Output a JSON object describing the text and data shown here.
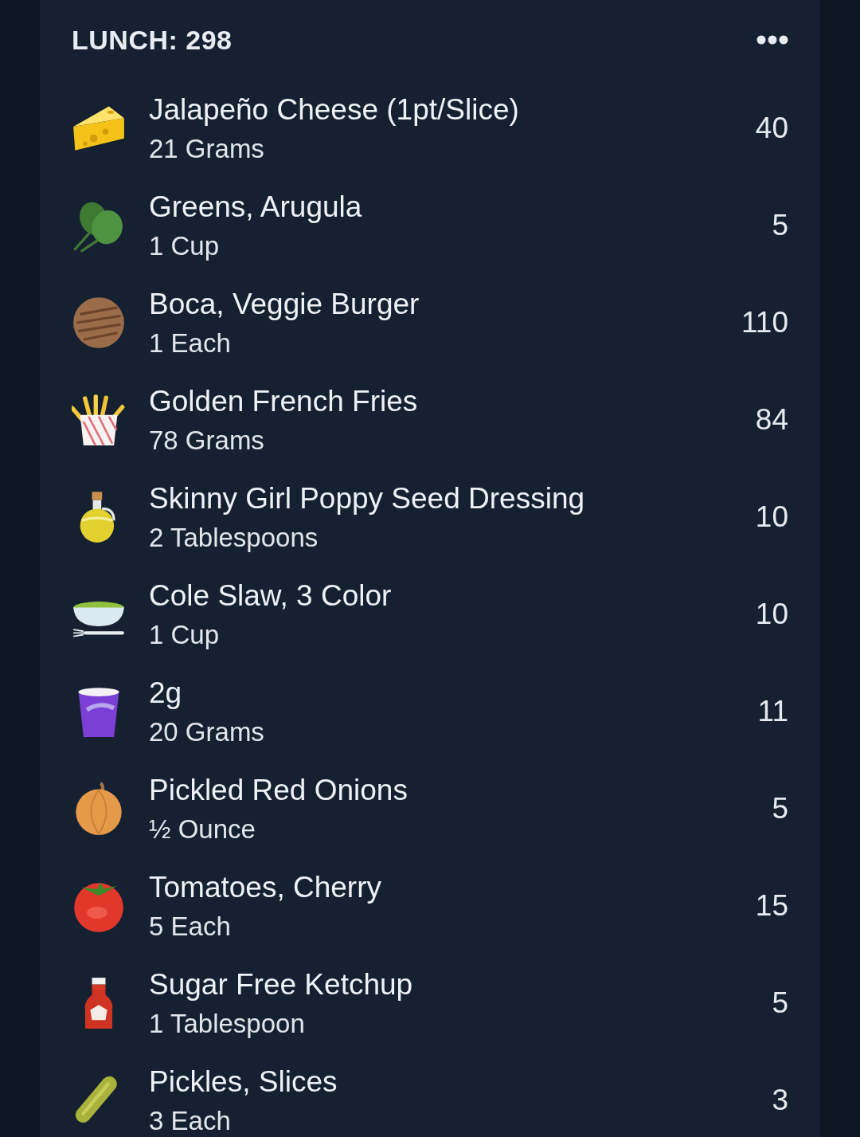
{
  "meal": {
    "title": "LUNCH: 298"
  },
  "items": [
    {
      "name": "Jalapeño Cheese (1pt/Slice)",
      "serving": "21 Grams",
      "calories": "40"
    },
    {
      "name": "Greens, Arugula",
      "serving": "1 Cup",
      "calories": "5"
    },
    {
      "name": "Boca, Veggie Burger",
      "serving": "1 Each",
      "calories": "110"
    },
    {
      "name": "Golden French Fries",
      "serving": "78 Grams",
      "calories": "84"
    },
    {
      "name": "Skinny Girl Poppy Seed Dressing",
      "serving": "2 Tablespoons",
      "calories": "10"
    },
    {
      "name": "Cole Slaw, 3 Color",
      "serving": "1 Cup",
      "calories": "10"
    },
    {
      "name": "2g",
      "serving": "20 Grams",
      "calories": "11"
    },
    {
      "name": "Pickled Red Onions",
      "serving": "½ Ounce",
      "calories": "5"
    },
    {
      "name": "Tomatoes, Cherry",
      "serving": "5 Each",
      "calories": "15"
    },
    {
      "name": "Sugar Free Ketchup",
      "serving": "1 Tablespoon",
      "calories": "5"
    },
    {
      "name": "Pickles, Slices",
      "serving": "3 Each",
      "calories": "3"
    }
  ]
}
